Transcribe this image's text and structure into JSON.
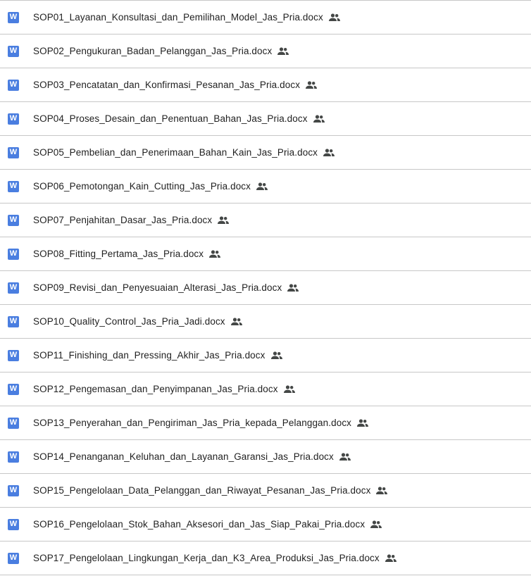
{
  "file_icon_letter": "W",
  "colors": {
    "word_icon": "#4a7ee0",
    "text": "#1f1f1f",
    "divider": "#c7c7c7",
    "shared_icon": "#444746"
  },
  "files": [
    {
      "name": "SOP01_Layanan_Konsultasi_dan_Pemilihan_Model_Jas_Pria.docx",
      "icon": "word-icon",
      "shared": true
    },
    {
      "name": "SOP02_Pengukuran_Badan_Pelanggan_Jas_Pria.docx",
      "icon": "word-icon",
      "shared": true
    },
    {
      "name": "SOP03_Pencatatan_dan_Konfirmasi_Pesanan_Jas_Pria.docx",
      "icon": "word-icon",
      "shared": true
    },
    {
      "name": "SOP04_Proses_Desain_dan_Penentuan_Bahan_Jas_Pria.docx",
      "icon": "word-icon",
      "shared": true
    },
    {
      "name": "SOP05_Pembelian_dan_Penerimaan_Bahan_Kain_Jas_Pria.docx",
      "icon": "word-icon",
      "shared": true
    },
    {
      "name": "SOP06_Pemotongan_Kain_Cutting_Jas_Pria.docx",
      "icon": "word-icon",
      "shared": true
    },
    {
      "name": "SOP07_Penjahitan_Dasar_Jas_Pria.docx",
      "icon": "word-icon",
      "shared": true
    },
    {
      "name": "SOP08_Fitting_Pertama_Jas_Pria.docx",
      "icon": "word-icon",
      "shared": true
    },
    {
      "name": "SOP09_Revisi_dan_Penyesuaian_Alterasi_Jas_Pria.docx",
      "icon": "word-icon",
      "shared": true
    },
    {
      "name": "SOP10_Quality_Control_Jas_Pria_Jadi.docx",
      "icon": "word-icon",
      "shared": true
    },
    {
      "name": "SOP11_Finishing_dan_Pressing_Akhir_Jas_Pria.docx",
      "icon": "word-icon",
      "shared": true
    },
    {
      "name": "SOP12_Pengemasan_dan_Penyimpanan_Jas_Pria.docx",
      "icon": "word-icon",
      "shared": true
    },
    {
      "name": "SOP13_Penyerahan_dan_Pengiriman_Jas_Pria_kepada_Pelanggan.docx",
      "icon": "word-icon",
      "shared": true
    },
    {
      "name": "SOP14_Penanganan_Keluhan_dan_Layanan_Garansi_Jas_Pria.docx",
      "icon": "word-icon",
      "shared": true
    },
    {
      "name": "SOP15_Pengelolaan_Data_Pelanggan_dan_Riwayat_Pesanan_Jas_Pria.docx",
      "icon": "word-icon",
      "shared": true
    },
    {
      "name": "SOP16_Pengelolaan_Stok_Bahan_Aksesori_dan_Jas_Siap_Pakai_Pria.docx",
      "icon": "word-icon",
      "shared": true
    },
    {
      "name": "SOP17_Pengelolaan_Lingkungan_Kerja_dan_K3_Area_Produksi_Jas_Pria.docx",
      "icon": "word-icon",
      "shared": true
    }
  ]
}
